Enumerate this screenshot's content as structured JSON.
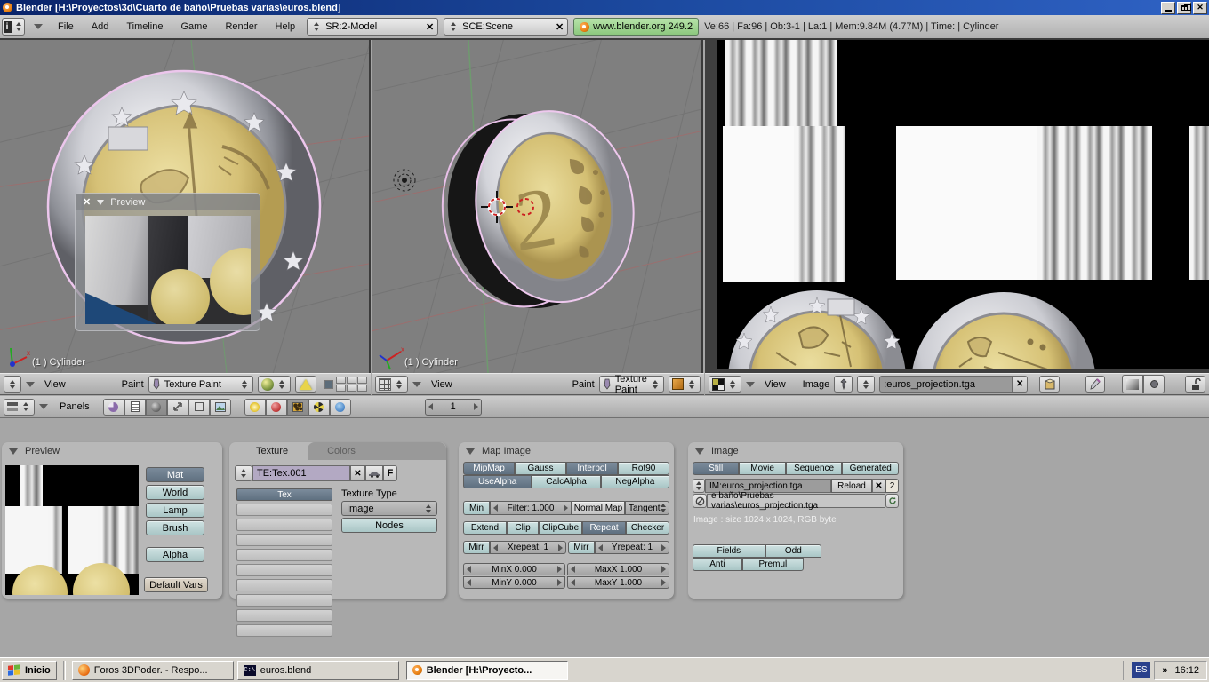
{
  "icons": {
    "close": "✕",
    "chevron": "»",
    "console": "C:\\"
  },
  "window": {
    "title": "Blender [H:\\Proyectos\\3d\\Cuarto de baño\\Pruebas varias\\euros.blend]"
  },
  "header": {
    "menus": [
      "File",
      "Add",
      "Timeline",
      "Game",
      "Render",
      "Help"
    ],
    "screen": "SR:2-Model",
    "scene": "SCE:Scene",
    "version": "www.blender.org 249.2",
    "stats": "Ve:66 | Fa:96 | Ob:3-1 | La:1  | Mem:9.84M (4.77M)  | Time: | Cylinder"
  },
  "viewports": {
    "left_label": "(1 ) Cylinder",
    "center_label": "(1 ) Cylinder",
    "coin_numeral": "2",
    "preview_float_title": "Preview"
  },
  "vp_header_1": {
    "view": "View",
    "paint": "Paint",
    "mode": "Texture Paint"
  },
  "vp_header_2": {
    "view": "View",
    "paint": "Paint",
    "mode": "Texture Paint"
  },
  "image_header": {
    "view": "View",
    "image": "Image",
    "datablock": ":euros_projection.tga"
  },
  "buttons_header": {
    "panels": "Panels",
    "page": "1"
  },
  "preview_panel": {
    "title": "Preview",
    "mat": "Mat",
    "world": "World",
    "lamp": "Lamp",
    "brush": "Brush",
    "alpha": "Alpha",
    "default_vars": "Default Vars"
  },
  "texture_panel": {
    "tab_texture": "Texture",
    "tab_colors": "Colors",
    "datablock": "TE:Tex.001",
    "auto_name": "F",
    "slot": "Tex",
    "type_label": "Texture Type",
    "type_value": "Image",
    "nodes": "Nodes"
  },
  "map_image_panel": {
    "title": "Map Image",
    "mipmap": "MipMap",
    "gauss": "Gauss",
    "interpol": "Interpol",
    "rot90": "Rot90",
    "usealpha": "UseAlpha",
    "calcalpha": "CalcAlpha",
    "negalpha": "NegAlpha",
    "min": "Min",
    "filter": "Filter: 1.000",
    "normal_map": "Normal Map",
    "tangent": "Tangent",
    "extend": "Extend",
    "clip": "Clip",
    "clipcube": "ClipCube",
    "repeat": "Repeat",
    "checker": "Checker",
    "mirr_x": "Mirr",
    "xrepeat": "Xrepeat: 1",
    "mirr_y": "Mirr",
    "yrepeat": "Yrepeat: 1",
    "minx": "MinX 0.000",
    "maxx": "MaxX 1.000",
    "miny": "MinY 0.000",
    "maxy": "MaxY 1.000"
  },
  "image_panel": {
    "title": "Image",
    "still": "Still",
    "movie": "Movie",
    "sequence": "Sequence",
    "generated": "Generated",
    "datablock": "IM:euros_projection.tga",
    "reload": "Reload",
    "users": "2",
    "path": "e baño\\Pruebas varias\\euros_projection.tga",
    "info": "Image : size 1024 x 1024, RGB byte",
    "fields": "Fields",
    "odd": "Odd",
    "anti": "Anti",
    "premul": "Premul"
  },
  "taskbar": {
    "start": "Inicio",
    "task_firefox": "Foros 3DPoder. - Respo...",
    "task_console": "euros.blend",
    "task_blender": "Blender [H:\\Proyecto...",
    "language": "ES",
    "clock": "16:12"
  }
}
